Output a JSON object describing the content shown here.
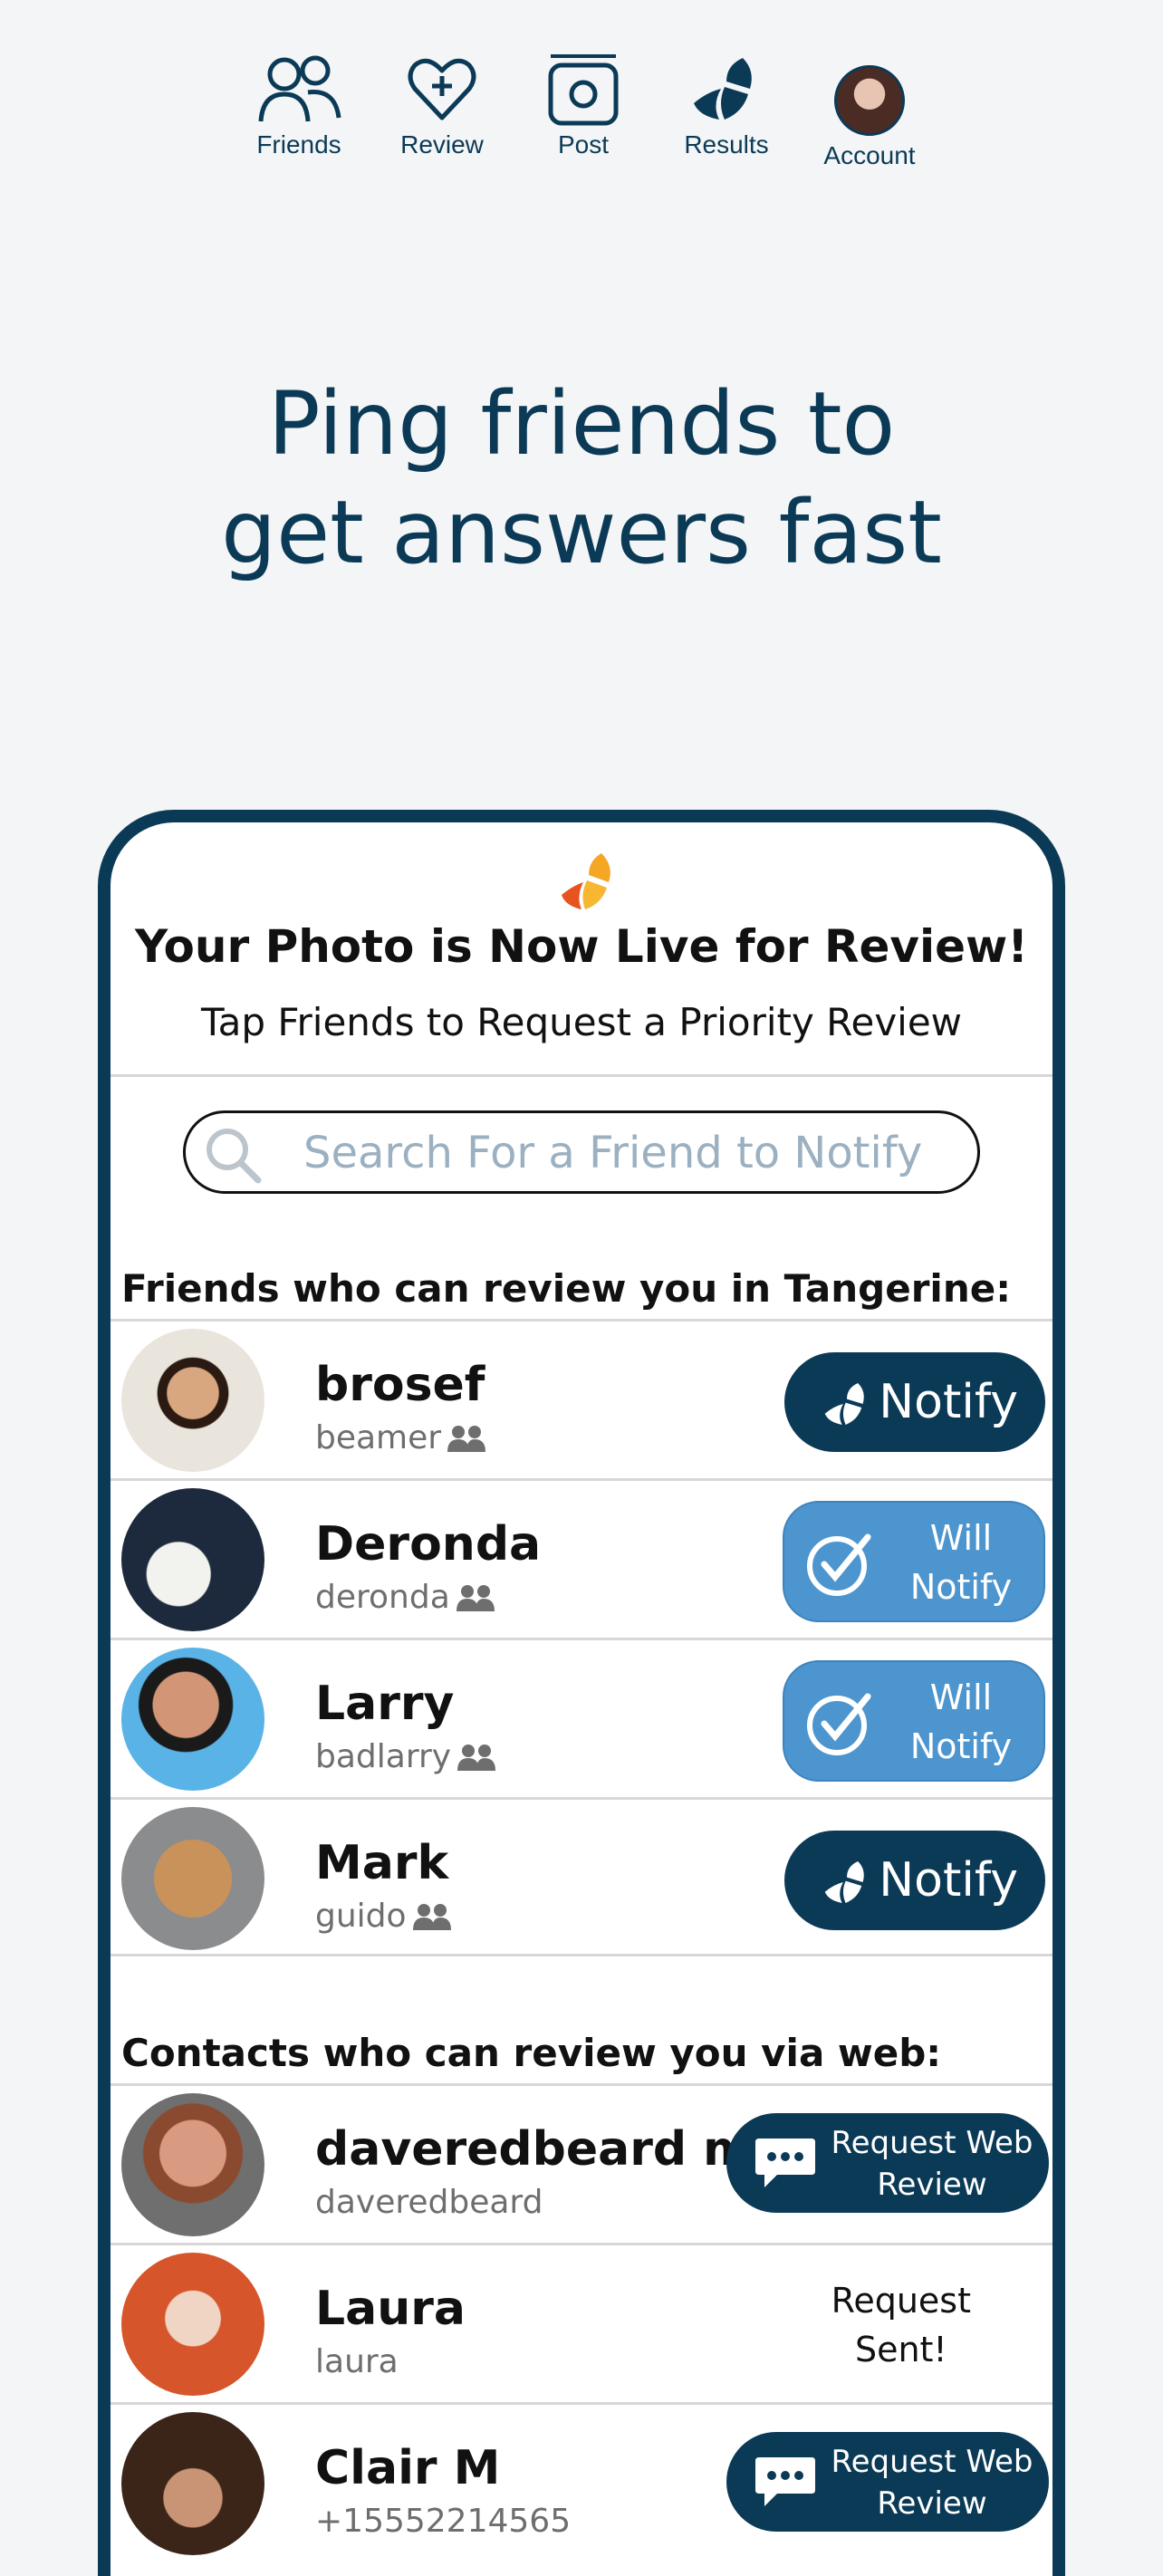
{
  "nav": {
    "friends": "Friends",
    "review": "Review",
    "post": "Post",
    "results": "Results",
    "account": "Account"
  },
  "hero": {
    "line1": "Ping friends to",
    "line2": "get answers fast"
  },
  "phone": {
    "title": "Your Photo is Now Live for Review!",
    "subtitle": "Tap Friends to Request a Priority Review",
    "search_placeholder": "Search For a Friend to Notify",
    "friends_heading": "Friends who can review you in Tangerine:",
    "contacts_heading": "Contacts who can review you via web:",
    "friends": [
      {
        "name": "brosef",
        "username": "beamer",
        "action": "Notify"
      },
      {
        "name": "Deronda",
        "username": "deronda",
        "action_line1": "Will",
        "action_line2": "Notify"
      },
      {
        "name": "Larry",
        "username": "badlarry",
        "action_line1": "Will",
        "action_line2": "Notify"
      },
      {
        "name": "Mark",
        "username": "guido",
        "action": "Notify"
      }
    ],
    "contacts": [
      {
        "name": "daveredbeard m...",
        "username": "daveredbeard",
        "action_line1": "Request Web",
        "action_line2": "Review"
      },
      {
        "name": "Laura",
        "username": "laura",
        "status_line1": "Request",
        "status_line2": "Sent!"
      },
      {
        "name": "Clair M",
        "username": "+15552214565",
        "action_line1": "Request Web",
        "action_line2": "Review"
      }
    ]
  },
  "colors": {
    "brand_navy": "#0b3a57",
    "will_notify_blue": "#4d95cf",
    "background": "#f4f5f6"
  }
}
